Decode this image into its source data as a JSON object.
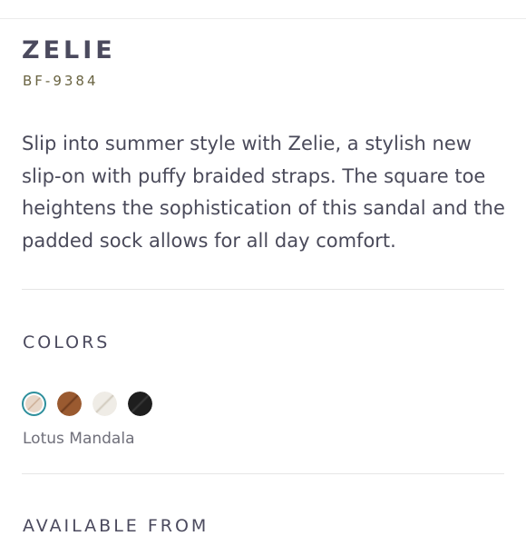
{
  "product": {
    "name": "ZELIE",
    "sku": "BF-9384",
    "description": "Slip into summer style with Zelie, a stylish new slip-on with puffy braided straps. The square toe heightens the sophistication of this sandal and the padded sock allows for all day comfort."
  },
  "colors": {
    "heading": "COLORS",
    "selected_name": "Lotus Mandala",
    "accent": "#2e8f9c",
    "swatches": [
      {
        "name": "lotus-mandala",
        "base": "#e7d6c8",
        "detail": "#c9a990",
        "selected": true
      },
      {
        "name": "cognac",
        "base": "#9a5a30",
        "detail": "#6d3a1c",
        "selected": false
      },
      {
        "name": "white",
        "base": "#efece6",
        "detail": "#cfc8bb",
        "selected": false
      },
      {
        "name": "black",
        "base": "#1e1e1e",
        "detail": "#3a3a3a",
        "selected": false
      }
    ]
  },
  "available_from": {
    "heading": "AVAILABLE FROM"
  }
}
